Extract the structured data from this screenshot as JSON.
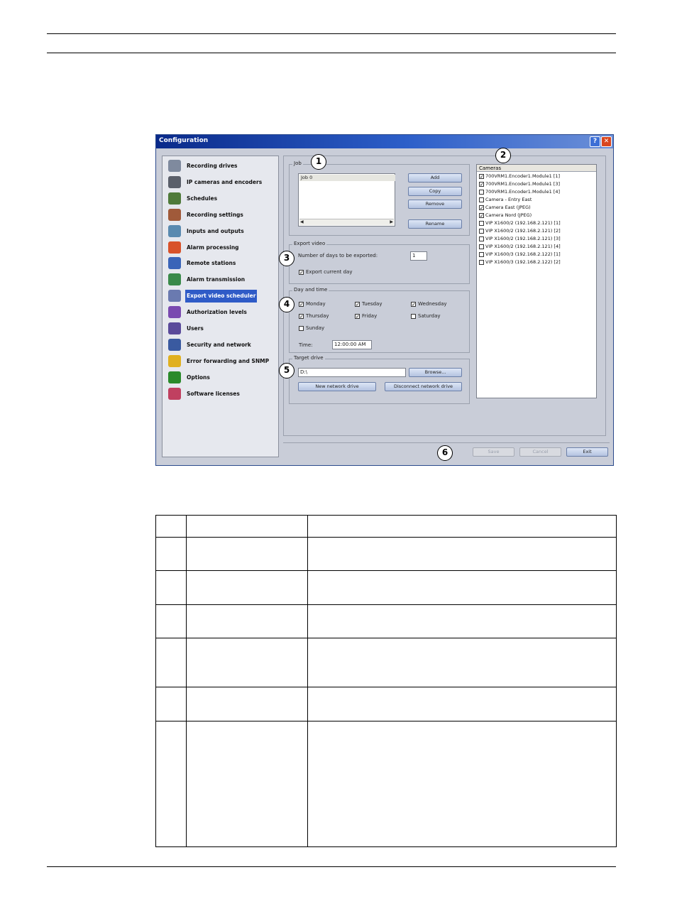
{
  "window": {
    "title": "Configuration",
    "help_glyph": "?",
    "close_glyph": "✕"
  },
  "sidebar": {
    "items": [
      {
        "label": "Recording drives",
        "icon": "drive-icon",
        "color": "#7f8a9e"
      },
      {
        "label": "IP cameras and encoders",
        "icon": "camera-icon",
        "color": "#5a5f6a"
      },
      {
        "label": "Schedules",
        "icon": "schedule-grid-icon",
        "color": "#4f7a3a"
      },
      {
        "label": "Recording settings",
        "icon": "recording-settings-icon",
        "color": "#a05a3a"
      },
      {
        "label": "Inputs and outputs",
        "icon": "inputs-outputs-icon",
        "color": "#5a8ab0"
      },
      {
        "label": "Alarm processing",
        "icon": "alarm-bell-icon",
        "color": "#d8522a"
      },
      {
        "label": "Remote stations",
        "icon": "monitor-icon",
        "color": "#3a64b8"
      },
      {
        "label": "Alarm transmission",
        "icon": "alarm-transmission-icon",
        "color": "#3a8a4a"
      },
      {
        "label": "Export video scheduler",
        "icon": "export-scheduler-icon",
        "color": "#6a7ab0",
        "selected": true
      },
      {
        "label": "Authorization levels",
        "icon": "users-group-icon",
        "color": "#7a4ab0"
      },
      {
        "label": "Users",
        "icon": "users-icon",
        "color": "#5a4a9a"
      },
      {
        "label": "Security and network",
        "icon": "security-network-icon",
        "color": "#3a5aa0"
      },
      {
        "label": "Error forwarding and SNMP",
        "icon": "warning-icon",
        "color": "#e0b020"
      },
      {
        "label": "Options",
        "icon": "checkmark-icon",
        "color": "#2a8a2a"
      },
      {
        "label": "Software licenses",
        "icon": "license-icon",
        "color": "#c04060"
      }
    ]
  },
  "job": {
    "group_label": "Job",
    "list_item": "Job  0",
    "buttons": {
      "add": "Add",
      "copy": "Copy",
      "remove": "Remove",
      "rename": "Rename"
    }
  },
  "export_video": {
    "group_label": "Export video",
    "days_label": "Number of days to be exported:",
    "days_value": "1",
    "export_current_day_label": "Export current day",
    "export_current_day_checked": true
  },
  "day_time": {
    "group_label": "Day and time",
    "days": [
      {
        "label": "Monday",
        "checked": true
      },
      {
        "label": "Tuesday",
        "checked": true
      },
      {
        "label": "Wednesday",
        "checked": true
      },
      {
        "label": "Thursday",
        "checked": true
      },
      {
        "label": "Friday",
        "checked": true
      },
      {
        "label": "Saturday",
        "checked": false
      },
      {
        "label": "Sunday",
        "checked": false
      }
    ],
    "time_label": "Time:",
    "time_value": "12:00:00 AM"
  },
  "target_drive": {
    "group_label": "Target drive",
    "path": "D:\\",
    "browse": "Browse...",
    "new_network_drive": "New network drive",
    "disconnect_network_drive": "Disconnect network drive"
  },
  "cameras": {
    "header": "Cameras",
    "items": [
      {
        "label": "700VRM1.Encoder1.Module1 [1]",
        "checked": true
      },
      {
        "label": "700VRM1.Encoder1.Module1 [3]",
        "checked": true
      },
      {
        "label": "700VRM1.Encoder1.Module1 [4]",
        "checked": false
      },
      {
        "label": "Camera - Entry East",
        "checked": false
      },
      {
        "label": "Camera East (JPEG)",
        "checked": true
      },
      {
        "label": "Camera Nord (JPEG)",
        "checked": true
      },
      {
        "label": "VIP X1600/2 (192.168.2.121) [1]",
        "checked": false
      },
      {
        "label": "VIP X1600/2 (192.168.2.121) [2]",
        "checked": false
      },
      {
        "label": "VIP X1600/2 (192.168.2.121) [3]",
        "checked": false
      },
      {
        "label": "VIP X1600/2 (192.168.2.121) [4]",
        "checked": false
      },
      {
        "label": "VIP X1600/3 (192.168.2.122) [1]",
        "checked": false
      },
      {
        "label": "VIP X1600/3 (192.168.2.122) [2]",
        "checked": false
      }
    ]
  },
  "footer_buttons": {
    "save": "Save",
    "cancel": "Cancel",
    "exit": "Exit"
  },
  "callouts": [
    "1",
    "2",
    "3",
    "4",
    "5",
    "6"
  ],
  "colors": {
    "title_bar": "#0a2a8a",
    "selection": "#2f5bc7",
    "window_bg": "#c9cdd8"
  }
}
